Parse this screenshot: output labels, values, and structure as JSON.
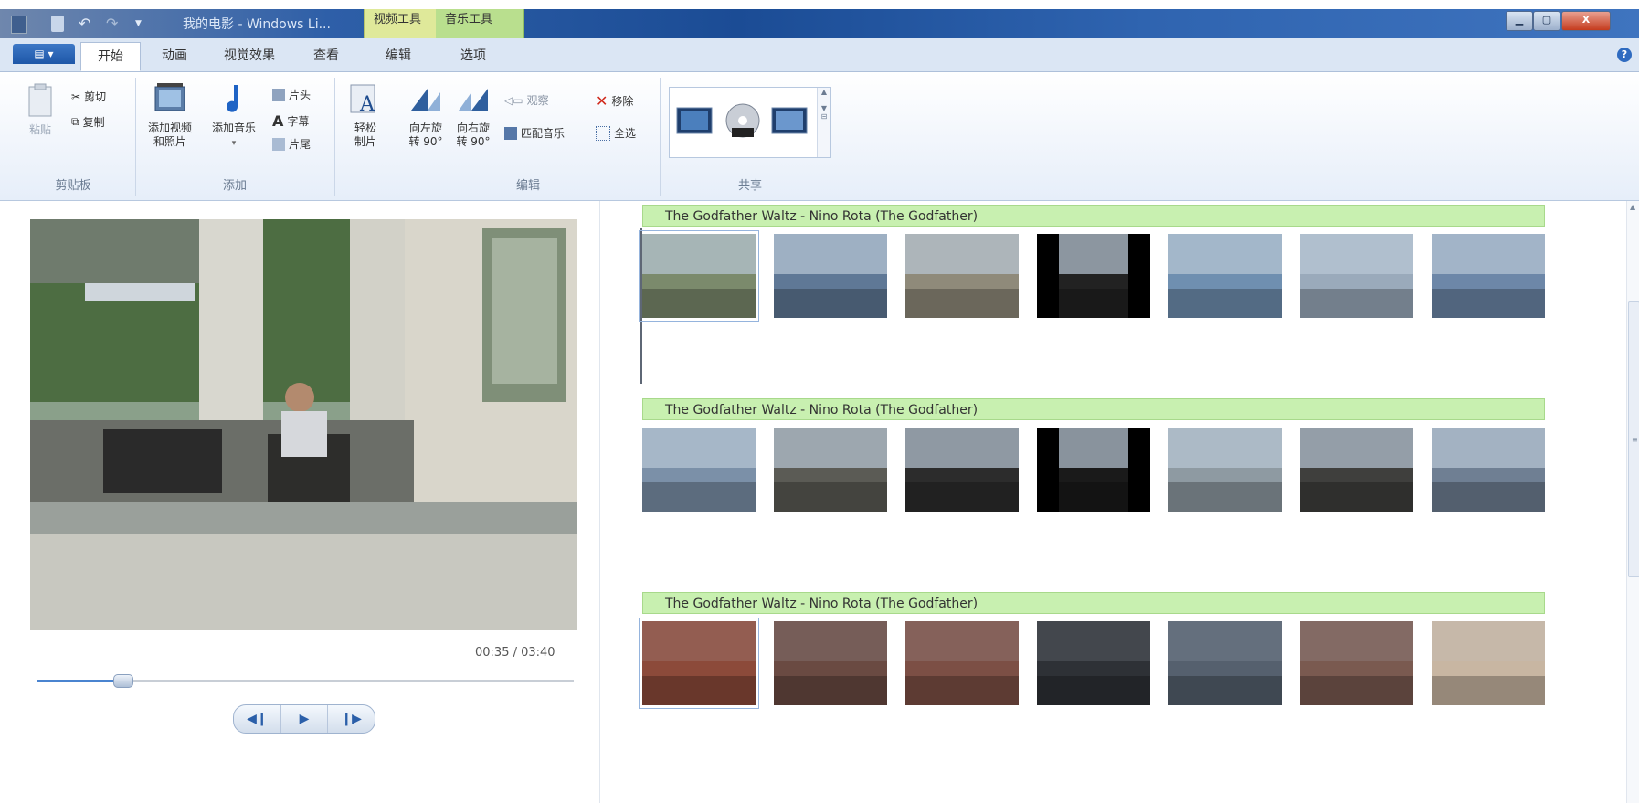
{
  "window": {
    "title": "我的电影 - Windows Li...",
    "context_tabs": [
      "视频工具",
      "音乐工具"
    ],
    "controls": {
      "close": "X"
    }
  },
  "ribbon_tabs": [
    "开始",
    "动画",
    "视觉效果",
    "查看",
    "编辑",
    "选项"
  ],
  "ribbon": {
    "clipboard": {
      "paste": "粘贴",
      "cut": "剪切",
      "copy": "复制",
      "group": "剪贴板"
    },
    "add": {
      "add_video": "添加视频\n和照片",
      "add_music": "添加音乐",
      "title": "片头",
      "caption": "字幕",
      "credits": "片尾",
      "group": "添加"
    },
    "automovie": {
      "label": "轻松\n制片"
    },
    "editing": {
      "rotate_left": "向左旋\n转 90°",
      "rotate_right": "向右旋\n转 90°",
      "snapshot": "观察",
      "fit_music": "匹配音乐",
      "remove": "移除",
      "select_all": "全选",
      "group": "编辑"
    },
    "share": {
      "group": "共享"
    }
  },
  "preview": {
    "time": "00:35 / 03:40",
    "progress": 0.16
  },
  "storyboard": {
    "music_label": "The Godfather Waltz - Nino Rota (The Godfather)",
    "rows": [
      {
        "clips": [
          "c1",
          "c2",
          "c3",
          "c4",
          "c5",
          "c6",
          "c7"
        ]
      },
      {
        "clips": [
          "c8",
          "c9",
          "c10",
          "c11",
          "c12",
          "c13",
          "c14"
        ]
      },
      {
        "clips": [
          "c15",
          "c16",
          "c17",
          "c18",
          "c19",
          "c20",
          "c21"
        ]
      }
    ]
  }
}
